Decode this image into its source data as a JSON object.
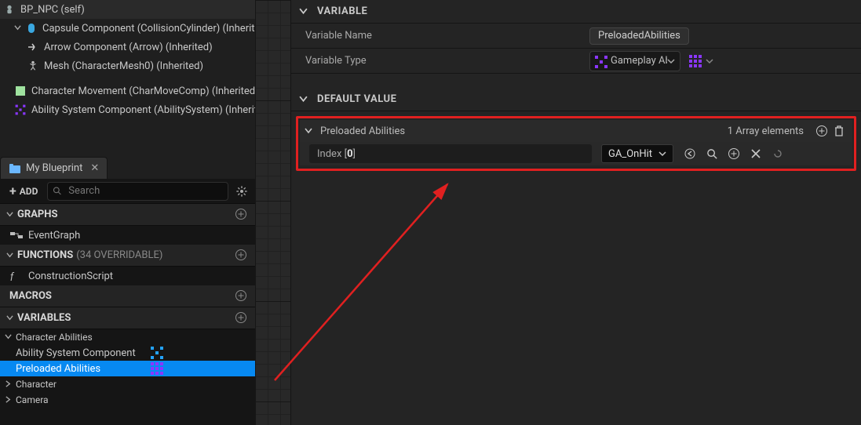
{
  "components": {
    "root": "BP_NPC (self)",
    "capsule": "Capsule Component (CollisionCylinder) (Inherited)",
    "arrow": "Arrow Component (Arrow) (Inherited)",
    "mesh": "Mesh (CharacterMesh0) (Inherited)",
    "move": "Character Movement (CharMoveComp) (Inherited)",
    "asc": "Ability System Component (AbilitySystem) (Inherited)"
  },
  "tab": {
    "title": "My Blueprint"
  },
  "toolbar": {
    "add": "ADD",
    "search_placeholder": "Search"
  },
  "sections": {
    "graphs": "GRAPHS",
    "functions": "FUNCTIONS",
    "functions_sub": "(34 OVERRIDABLE)",
    "macros": "MACROS",
    "variables": "VARIABLES"
  },
  "graph_items": {
    "event": "EventGraph"
  },
  "func_items": {
    "construct": "ConstructionScript"
  },
  "var_cats": {
    "cat1": "Character Abilities",
    "cat2": "Character",
    "cat3": "Camera"
  },
  "vars": {
    "asc": "Ability System Component",
    "preloaded": "Preloaded Abilities"
  },
  "panel": {
    "variable_header": "VARIABLE",
    "var_name_label": "Variable Name",
    "var_name_value": "PreloadedAbilities",
    "var_type_label": "Variable Type",
    "var_type_value": "Gameplay Abi",
    "default_header": "DEFAULT VALUE",
    "arr_name": "Preloaded Abilities",
    "arr_count": "1 Array elements",
    "index_label_a": "Index [ ",
    "index_label_b": "0",
    "index_label_c": " ]",
    "elem_value": "GA_OnHit"
  }
}
